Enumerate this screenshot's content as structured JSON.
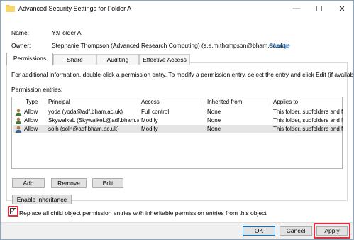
{
  "window": {
    "title": "Advanced Security Settings for Folder A",
    "minimize_glyph": "—",
    "maximize_glyph": "☐",
    "close_glyph": "✕",
    "icon": "folder-icon"
  },
  "header": {
    "name_label": "Name:",
    "name_value": "Y:\\Folder A",
    "owner_label": "Owner:",
    "owner_value": "Stephanie Thompson (Advanced Research Computing) (s.e.m.thompson@bham.ac.uk)",
    "change_link": "Change"
  },
  "tabs": [
    {
      "label": "Permissions",
      "active": true
    },
    {
      "label": "Share",
      "active": false
    },
    {
      "label": "Auditing",
      "active": false
    },
    {
      "label": "Effective Access",
      "active": false
    }
  ],
  "info_text": "For additional information, double-click a permission entry. To modify a permission entry, select the entry and click Edit (if available).",
  "entries_label": "Permission entries:",
  "table": {
    "columns": [
      "Type",
      "Principal",
      "Access",
      "Inherited from",
      "Applies to"
    ],
    "rows": [
      {
        "type": "Allow",
        "principal": "yoda (yoda@adf.bham.ac.uk)",
        "access": "Full control",
        "inherited": "None",
        "applies": "This folder, subfolders and files",
        "highlighted": false
      },
      {
        "type": "Allow",
        "principal": "SkywalkeL (SkywalkeL@adf.bham.ac",
        "access": "Modify",
        "inherited": "None",
        "applies": "This folder, subfolders and files",
        "highlighted": false
      },
      {
        "type": "Allow",
        "principal": "solh (solh@adf.bham.ac.uk)",
        "access": "Modify",
        "inherited": "None",
        "applies": "This folder, subfolders and files",
        "highlighted": true
      }
    ]
  },
  "buttons": {
    "add": "Add",
    "remove": "Remove",
    "edit": "Edit",
    "enable_inheritance": "Enable inheritance",
    "ok": "OK",
    "cancel": "Cancel",
    "apply": "Apply"
  },
  "replace_checkbox": {
    "label": "Replace all child object permission entries with inheritable permission entries from this object",
    "checked": true,
    "check_glyph": "✓"
  },
  "colors": {
    "highlight": "#e03040",
    "link": "#0066cc",
    "accent": "#0078d7"
  }
}
